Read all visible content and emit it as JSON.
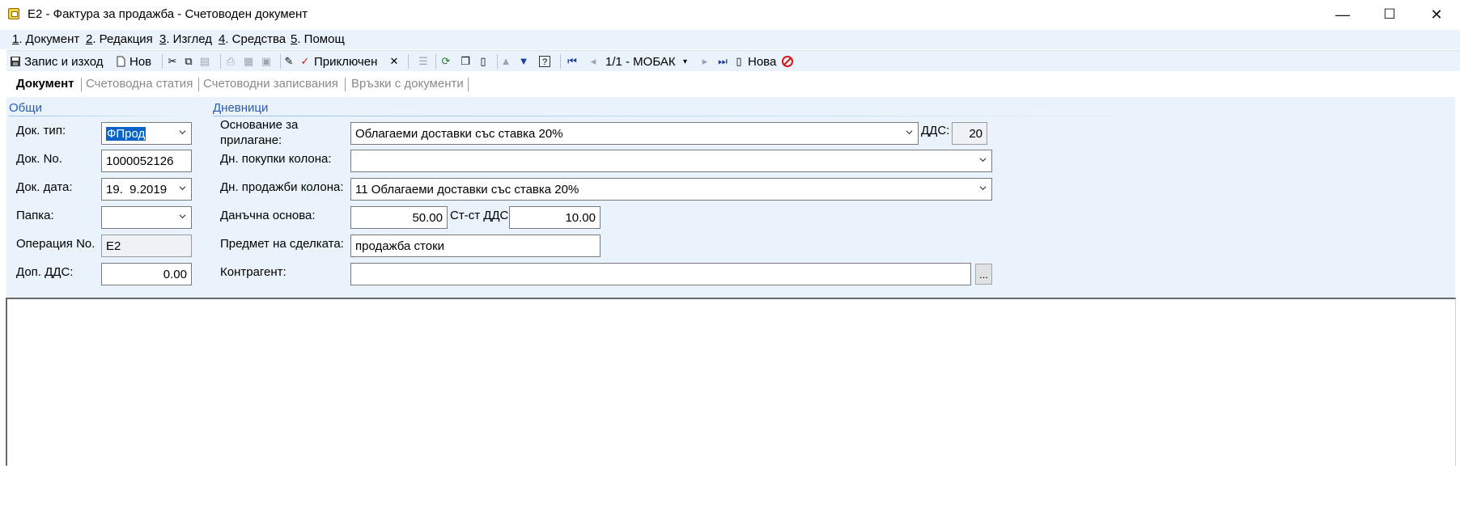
{
  "window": {
    "title": "E2 - Фактура за продажба - Счетоводен документ",
    "minimize": "—",
    "maximize": "☐",
    "close": "✕"
  },
  "menu": {
    "items": [
      {
        "num": "1",
        "label": ". Документ"
      },
      {
        "num": "2",
        "label": ". Редакция"
      },
      {
        "num": "3",
        "label": ". Изглед"
      },
      {
        "num": "4",
        "label": ". Средства"
      },
      {
        "num": "5",
        "label": ". Помощ"
      }
    ]
  },
  "toolbar": {
    "save_exit": "Запис и изход",
    "new": "Нов",
    "completed": "Приключен",
    "record_nav": "1/1 - МОБАК",
    "new_record": "Нова"
  },
  "tabs": [
    {
      "label": "Документ"
    },
    {
      "label": "Счетоводна статия"
    },
    {
      "label": "Счетоводни записвания"
    },
    {
      "label": "Връзки с документи"
    }
  ],
  "general": {
    "title": "Общи",
    "doc_type_label": "Док. тип:",
    "doc_type_value": "ФПрод",
    "doc_no_label": "Док. No.",
    "doc_no_value": "1000052126",
    "doc_date_label": "Док. дата:",
    "doc_date_value": "19.  9.2019",
    "folder_label": "Папка:",
    "folder_value": "",
    "operation_label": "Операция No.",
    "operation_value": "E2",
    "extra_vat_label": "Доп. ДДС:",
    "extra_vat_value": "0.00"
  },
  "journals": {
    "title": "Дневници",
    "basis_label_1": "Основание за",
    "basis_label_2": "прилагане:",
    "basis_value": "Облагаеми доставки със ставка 20%",
    "vat_label": "ДДС:",
    "vat_value": "20",
    "purchase_col_label": "Дн. покупки колона:",
    "purchase_col_value": "",
    "sales_col_label": "Дн. продажби колона:",
    "sales_col_value": "11 Облагаеми доставки със ставка 20%",
    "tax_base_label": "Данъчна основа:",
    "tax_base_value": "50.00",
    "vat_amount_label": "Ст-ст ДДС:",
    "vat_amount_value": "10.00",
    "subject_label": "Предмет на сделката:",
    "subject_value": "продажба стоки",
    "counterparty_label": "Контрагент:",
    "counterparty_value": "",
    "counterparty_button": "..."
  }
}
